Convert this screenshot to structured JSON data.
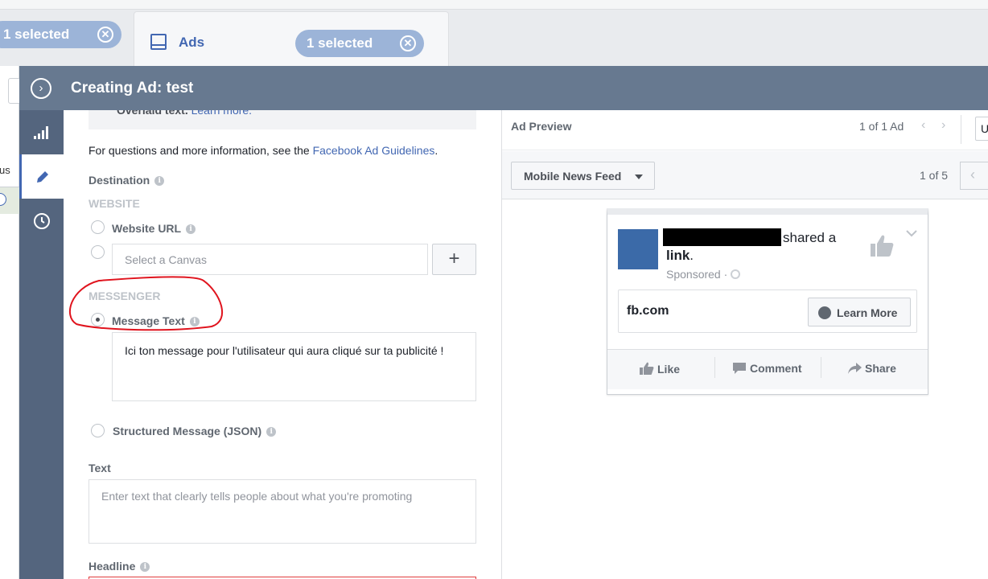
{
  "tabs": {
    "left_pill": "1 selected",
    "ads_tab": "Ads",
    "right_pill": "1 selected",
    "close_glyph": "⊗"
  },
  "background": {
    "fragment_text": "us"
  },
  "header": {
    "title": "Creating Ad: test",
    "collapse_glyph": "›"
  },
  "sidebar": {
    "items": [
      {
        "icon": "bar-chart-icon",
        "active": false
      },
      {
        "icon": "pencil-icon",
        "active": true
      },
      {
        "icon": "clock-icon",
        "active": false
      }
    ]
  },
  "form": {
    "overlaid_text": "Overlaid text.",
    "overlaid_link": "Learn more.",
    "guidelines_prefix": "For questions and more information, see the ",
    "guidelines_link": "Facebook Ad Guidelines",
    "guidelines_suffix": ".",
    "destination_label": "Destination",
    "website_heading": "WEBSITE",
    "website_url_label": "Website URL",
    "canvas_placeholder": "Select a Canvas",
    "plus_glyph": "+",
    "messenger_heading": "MESSENGER",
    "message_text_label": "Message Text",
    "message_text_value": "Ici ton message pour l'utilisateur qui aura cliqué sur ta publicité !",
    "structured_message_label": "Structured Message (JSON)",
    "text_label": "Text",
    "text_placeholder": "Enter text that clearly tells people about what you're promoting",
    "headline_label": "Headline",
    "info_glyph": "i"
  },
  "preview": {
    "title": "Ad Preview",
    "ad_count": "1 of 1 Ad",
    "prev_glyph": "‹",
    "next_glyph": "›",
    "header_button_text": "U",
    "placement": "Mobile News Feed",
    "page_count": "1 of 5",
    "post": {
      "shared_text": "shared a",
      "link_word": "link",
      "link_period": ".",
      "sponsored": "Sponsored ·",
      "domain": "fb.com",
      "cta": "Learn More",
      "like": "Like",
      "comment": "Comment",
      "share": "Share"
    }
  },
  "colors": {
    "header_bg": "#677990",
    "sidebar_bg": "#54657e",
    "accent": "#4267b2",
    "pill_bg": "#9cb4d8",
    "annotation_red": "#e0141e"
  }
}
